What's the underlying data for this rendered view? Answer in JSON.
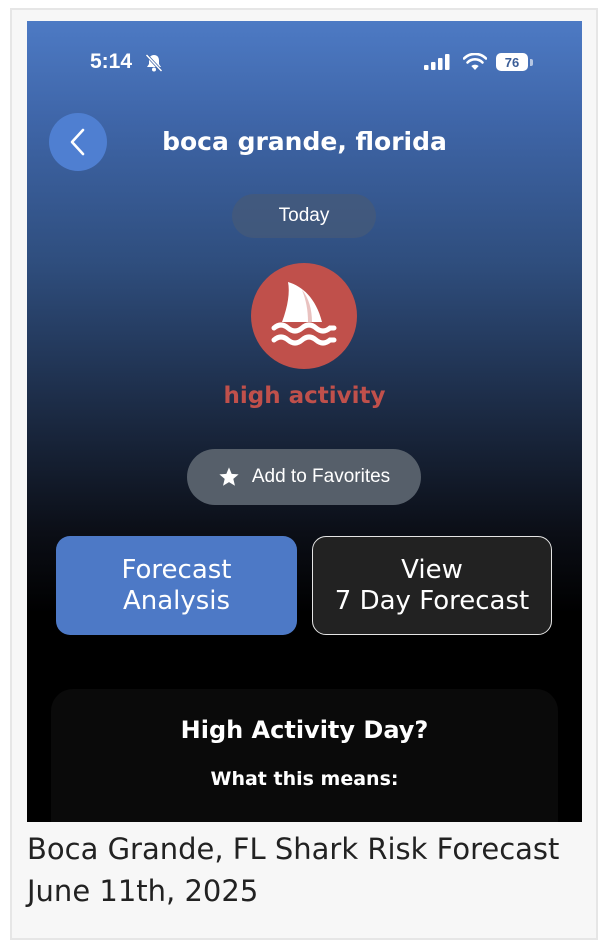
{
  "status_bar": {
    "time": "5:14",
    "battery": "76",
    "icons": [
      "bell-slash-icon",
      "cellular-signal-icon",
      "wifi-icon",
      "battery-icon"
    ]
  },
  "header": {
    "back_icon": "chevron-left-icon",
    "location": "boca grande, florida"
  },
  "day_selector": {
    "label": "Today"
  },
  "forecast": {
    "icon": "shark-fin-icon",
    "activity_level": "high activity",
    "activity_color": "#c0504b"
  },
  "favorites": {
    "icon": "star-icon",
    "label": "Add to Favorites"
  },
  "actions": {
    "forecast_analysis": {
      "line1": "Forecast",
      "line2": "Analysis"
    },
    "seven_day": {
      "line1": "View",
      "line2": "7 Day Forecast"
    }
  },
  "info": {
    "title": "High Activity Day?",
    "subtitle": "What this means:"
  },
  "caption": {
    "line1": "Boca Grande, FL Shark Risk Forecast",
    "line2": "June 11th, 2025"
  },
  "colors": {
    "accent_blue": "#4d79c6",
    "risk_red": "#c0504b"
  }
}
